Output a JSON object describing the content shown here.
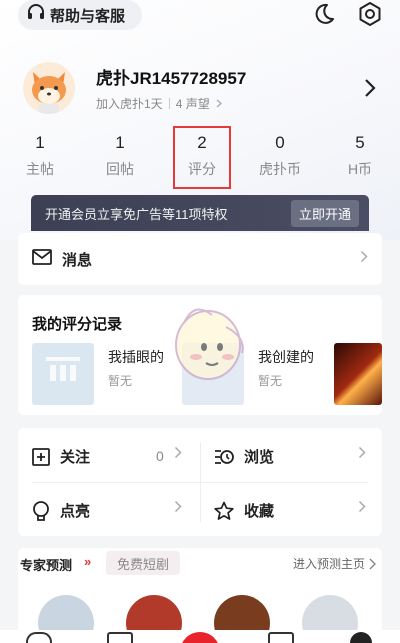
{
  "header": {
    "help_label": "帮助与客服"
  },
  "profile": {
    "username": "虎扑JR1457728957",
    "joined": "加入虎扑1天",
    "reputation": "4 声望"
  },
  "stats": [
    {
      "value": "1",
      "label": "主帖"
    },
    {
      "value": "1",
      "label": "回帖"
    },
    {
      "value": "2",
      "label": "评分"
    },
    {
      "value": "0",
      "label": "虎扑币"
    },
    {
      "value": "5",
      "label": "H币"
    }
  ],
  "vip": {
    "text": "开通会员立享免广告等11项特权",
    "button": "立即开通"
  },
  "messages": {
    "label": "消息"
  },
  "ratings": {
    "title": "我的评分记录",
    "items": [
      {
        "title": "我插眼的",
        "sub": "暂无"
      },
      {
        "title": "我创建的",
        "sub": "暂无"
      }
    ]
  },
  "actions": {
    "follow": {
      "label": "关注",
      "count": "0"
    },
    "browse": {
      "label": "浏览"
    },
    "likes": {
      "label": "点亮"
    },
    "favorites": {
      "label": "收藏"
    }
  },
  "expert": {
    "tab_active": "专家预测",
    "tab_other": "免费短剧",
    "more": "进入预测主页"
  },
  "colors": {
    "highlight_box": "#e33b3b",
    "vip_bg": "#3d4054",
    "avatar_bg": "#fdebd9"
  }
}
